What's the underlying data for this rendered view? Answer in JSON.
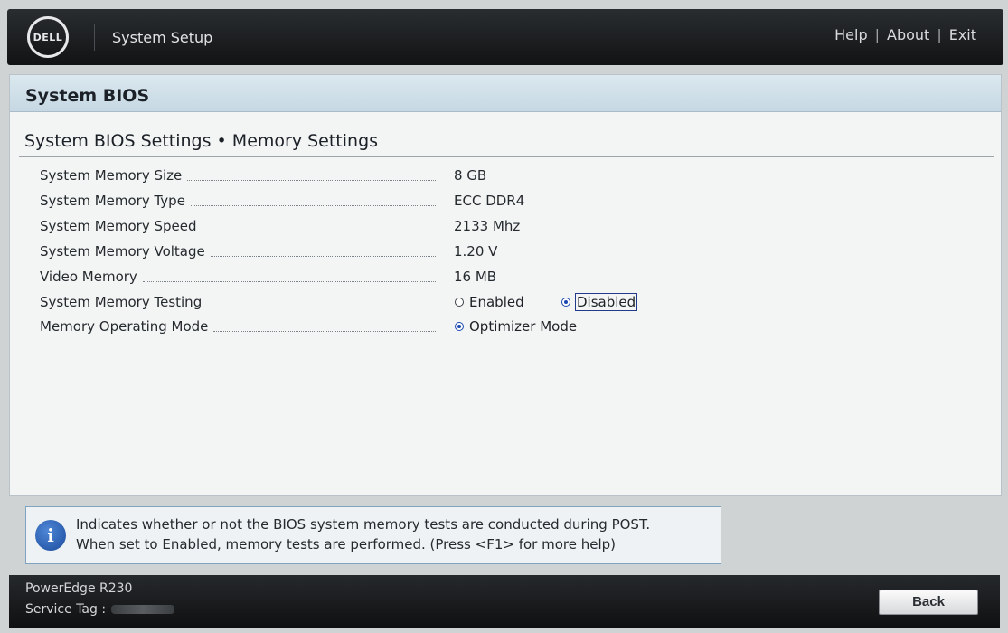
{
  "header": {
    "logo_text": "DELL",
    "app_title": "System Setup",
    "links": [
      "Help",
      "About",
      "Exit"
    ],
    "separator": "|"
  },
  "panel": {
    "title": "System BIOS",
    "heading": "System BIOS Settings • Memory Settings",
    "rows": [
      {
        "label": "System Memory Size",
        "value": "8 GB"
      },
      {
        "label": "System Memory Type",
        "value": "ECC DDR4"
      },
      {
        "label": "System Memory Speed",
        "value": "2133 Mhz"
      },
      {
        "label": "System Memory Voltage",
        "value": "1.20 V"
      },
      {
        "label": "Video Memory",
        "value": "16 MB"
      },
      {
        "label": "System Memory Testing",
        "options": [
          "Enabled",
          "Disabled"
        ],
        "selected": "Disabled"
      },
      {
        "label": "Memory Operating Mode",
        "options": [
          "Optimizer Mode"
        ],
        "selected": "Optimizer Mode"
      }
    ]
  },
  "help": {
    "icon": "info-icon",
    "line1": "Indicates whether or not the BIOS system memory tests are conducted during POST.",
    "line2": "When set to Enabled, memory tests are performed. (Press <F1> for more help)"
  },
  "footer": {
    "model": "PowerEdge R230",
    "service_tag_label": "Service Tag :",
    "back_label": "Back"
  },
  "colors": {
    "header_bg": "#111314",
    "panel_header_bg": "#c6d8e3",
    "radio_selected": "#1a48b0",
    "info_border": "#7fa3c0"
  }
}
